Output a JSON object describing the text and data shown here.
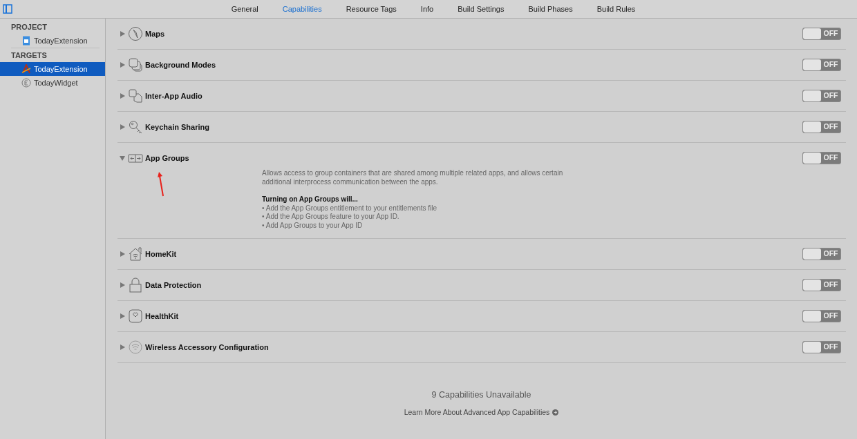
{
  "tabs": [
    {
      "label": "General",
      "selected": false
    },
    {
      "label": "Capabilities",
      "selected": true
    },
    {
      "label": "Resource Tags",
      "selected": false
    },
    {
      "label": "Info",
      "selected": false
    },
    {
      "label": "Build Settings",
      "selected": false
    },
    {
      "label": "Build Phases",
      "selected": false
    },
    {
      "label": "Build Rules",
      "selected": false
    }
  ],
  "sidebar": {
    "sections": [
      {
        "title": "PROJECT",
        "items": [
          {
            "label": "TodayExtension",
            "kind": "project",
            "selected": false
          }
        ]
      },
      {
        "title": "TARGETS",
        "items": [
          {
            "label": "TodayExtension",
            "kind": "app",
            "selected": true
          },
          {
            "label": "TodayWidget",
            "kind": "extension",
            "selected": false
          }
        ]
      }
    ]
  },
  "capabilities": [
    {
      "name": "Maps",
      "kind": "compass",
      "expanded": false,
      "on": false,
      "toggle_label": "OFF"
    },
    {
      "name": "Background Modes",
      "kind": "layers",
      "expanded": false,
      "on": false,
      "toggle_label": "OFF"
    },
    {
      "name": "Inter-App Audio",
      "kind": "audio",
      "expanded": false,
      "on": false,
      "toggle_label": "OFF"
    },
    {
      "name": "Keychain Sharing",
      "kind": "key",
      "expanded": false,
      "on": false,
      "toggle_label": "OFF"
    },
    {
      "name": "App Groups",
      "kind": "groups",
      "expanded": true,
      "on": false,
      "toggle_label": "OFF",
      "description": "Allows access to group containers that are shared among multiple related apps, and allows certain additional interprocess communication between the apps.",
      "steps_title": "Turning on App Groups will...",
      "steps": [
        "• Add the App Groups entitlement to your entitlements file",
        "• Add the App Groups feature to your App ID.",
        "• Add App Groups to your App ID"
      ]
    },
    {
      "name": "HomeKit",
      "kind": "home",
      "expanded": false,
      "on": false,
      "toggle_label": "OFF"
    },
    {
      "name": "Data Protection",
      "kind": "lock",
      "expanded": false,
      "on": false,
      "toggle_label": "OFF"
    },
    {
      "name": "HealthKit",
      "kind": "heart",
      "expanded": false,
      "on": false,
      "toggle_label": "OFF"
    },
    {
      "name": "Wireless Accessory Configuration",
      "kind": "wifi",
      "expanded": false,
      "on": false,
      "toggle_label": "OFF"
    }
  ],
  "footer": {
    "title": "9 Capabilities Unavailable",
    "link": "Learn More About Advanced App Capabilities"
  }
}
